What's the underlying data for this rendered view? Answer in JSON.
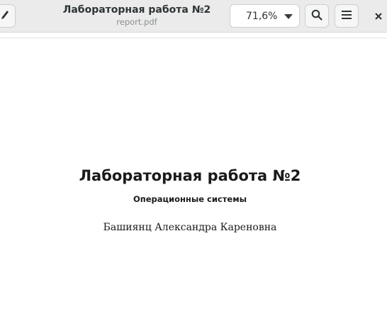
{
  "header": {
    "title": "Лабораторная работа №2",
    "subtitle": "report.pdf",
    "zoom_value": "71,6%",
    "icons": {
      "edit": "pencil-icon",
      "zoom_dropdown": "chevron-down-icon",
      "search": "search-icon",
      "menu": "hamburger-menu-icon",
      "close": "close-icon"
    }
  },
  "document": {
    "title": "Лабораторная работа №2",
    "subtitle": "Операционные системы",
    "author": "Башиянц Александра Кареновна"
  },
  "colors": {
    "headerbar_bg": "#ebebeb",
    "page_bg": "#ffffff",
    "text": "#1a1a1a"
  }
}
